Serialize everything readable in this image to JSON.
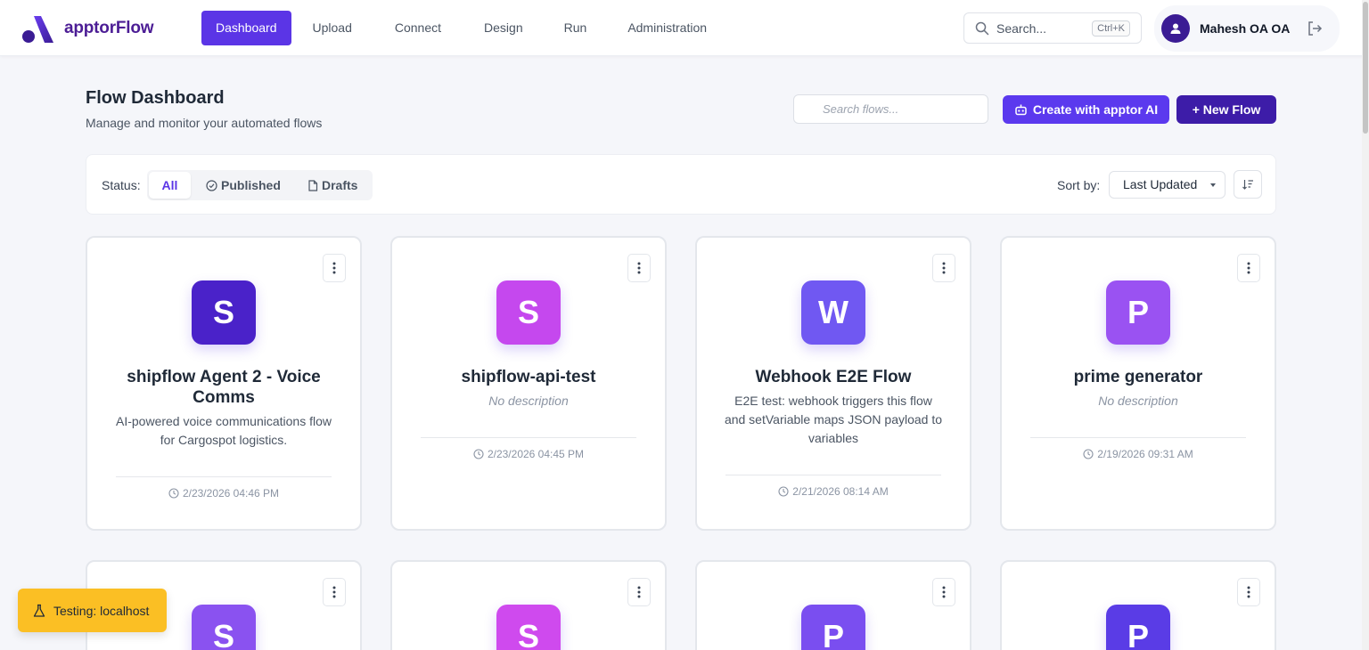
{
  "app": {
    "name": "apptorFlow"
  },
  "nav": [
    {
      "label": "Dashboard",
      "active": true
    },
    {
      "label": "Upload"
    },
    {
      "label": "Connect"
    },
    {
      "label": "Design"
    },
    {
      "label": "Run"
    },
    {
      "label": "Administration"
    }
  ],
  "global_search": {
    "placeholder": "Search...",
    "shortcut": "Ctrl+K"
  },
  "user": {
    "name": "Mahesh OA OA"
  },
  "page": {
    "title": "Flow Dashboard",
    "subtitle": "Manage and monitor your automated flows"
  },
  "flow_search": {
    "placeholder": "Search flows..."
  },
  "actions": {
    "ai_label": "Create with apptor AI",
    "new_label": "+ New Flow"
  },
  "filters": {
    "status_label": "Status:",
    "all": "All",
    "published": "Published",
    "drafts": "Drafts",
    "sort_label": "Sort by:",
    "sort_value": "Last Updated"
  },
  "colors": {
    "accent": "#5b35e6",
    "brand_dark": "#3d1ca8",
    "toast": "#fbbf24"
  },
  "flows": [
    {
      "initial": "S",
      "title": "shipflow Agent 2 - Voice Comms",
      "description": "AI-powered voice communications flow for Cargospot logistics.",
      "updated": "2/23/2026 04:46 PM",
      "color": "#4a22c9"
    },
    {
      "initial": "S",
      "title": "shipflow-api-test",
      "description": "No description",
      "updated": "2/23/2026 04:45 PM",
      "color": "#c548ee"
    },
    {
      "initial": "W",
      "title": "Webhook E2E Flow",
      "description": "E2E test: webhook triggers this flow and setVariable maps JSON payload to variables",
      "updated": "2/21/2026 08:14 AM",
      "color": "#7058f2"
    },
    {
      "initial": "P",
      "title": "prime generator",
      "description": "No description",
      "updated": "2/19/2026 09:31 AM",
      "color": "#9a52f2"
    },
    {
      "initial": "S",
      "color": "#8a52f0"
    },
    {
      "initial": "S",
      "color": "#cf4aee"
    },
    {
      "initial": "P",
      "color": "#7a4ef0"
    },
    {
      "initial": "P",
      "color": "#5a3ce6"
    }
  ],
  "toast": {
    "label": "Testing: localhost"
  }
}
